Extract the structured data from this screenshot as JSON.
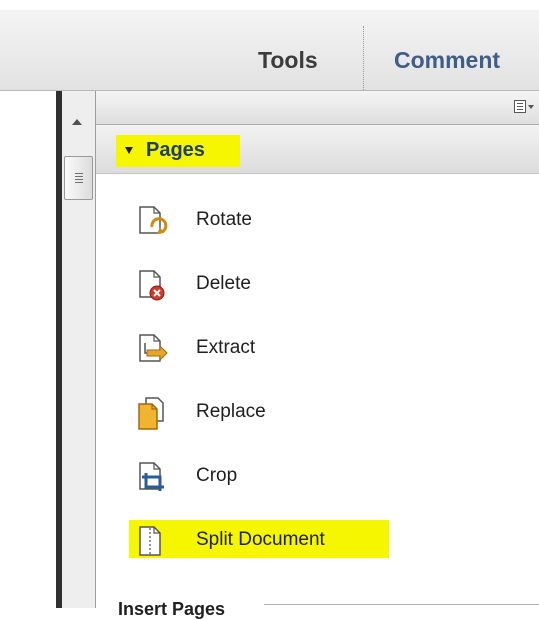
{
  "toolbar": {
    "tools_label": "Tools",
    "comment_label": "Comment"
  },
  "panel": {
    "section_title": "Pages",
    "items": [
      {
        "label": "Rotate",
        "icon": "rotate-page-icon"
      },
      {
        "label": "Delete",
        "icon": "delete-page-icon"
      },
      {
        "label": "Extract",
        "icon": "extract-page-icon"
      },
      {
        "label": "Replace",
        "icon": "replace-page-icon"
      },
      {
        "label": "Crop",
        "icon": "crop-page-icon"
      },
      {
        "label": "Split Document",
        "icon": "split-document-icon"
      }
    ],
    "next_section_title": "Insert Pages"
  },
  "colors": {
    "highlight": "#f6f600",
    "section_title": "#1f3f6f",
    "comment": "#3f5d86"
  }
}
